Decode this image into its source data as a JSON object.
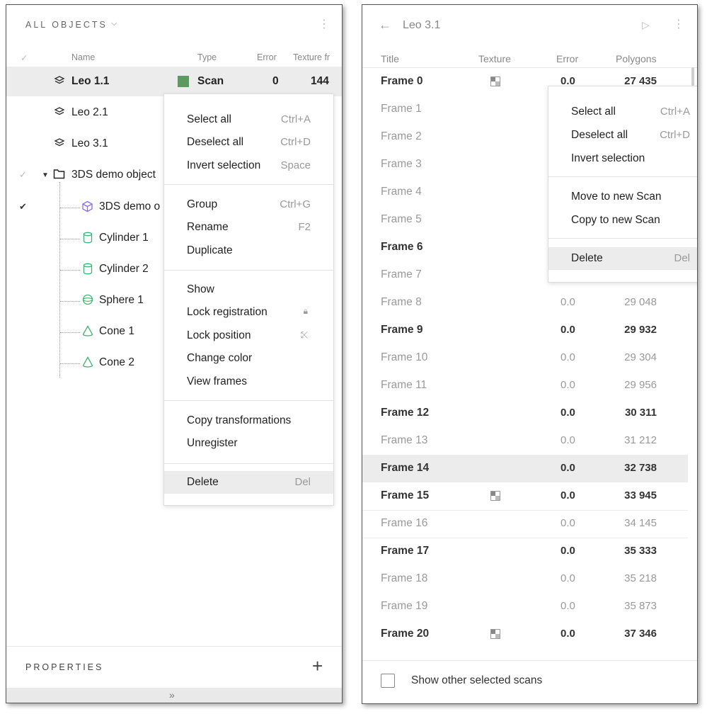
{
  "left_panel": {
    "header": {
      "title": "ALL OBJECTS",
      "chevron": "⌵",
      "kebab": "⋮"
    },
    "columns": {
      "check": "✓",
      "name": "Name",
      "type": "Type",
      "error": "Error",
      "texture": "Texture fr"
    },
    "rows": [
      {
        "label": "Leo 1.1",
        "type": "Scan",
        "error": "0",
        "texture": "144",
        "icon": "layers-icon"
      },
      {
        "label": "Leo 2.1",
        "icon": "layers-icon"
      },
      {
        "label": "Leo 3.1",
        "icon": "layers-icon"
      },
      {
        "label": "3DS demo object",
        "icon": "folder-icon",
        "check": "✓"
      },
      {
        "label": "3DS demo o",
        "icon": "cube-icon",
        "check": "✔"
      },
      {
        "label": "Cylinder 1",
        "icon": "cylinder-icon"
      },
      {
        "label": "Cylinder 2",
        "icon": "cylinder-icon"
      },
      {
        "label": "Sphere 1",
        "icon": "sphere-icon"
      },
      {
        "label": "Cone 1",
        "icon": "cone-icon"
      },
      {
        "label": "Cone 2",
        "icon": "cone-icon"
      }
    ],
    "context_menu": [
      {
        "label": "Select all",
        "shortcut": "Ctrl+A"
      },
      {
        "label": "Deselect all",
        "shortcut": "Ctrl+D"
      },
      {
        "label": "Invert selection",
        "shortcut": "Space"
      },
      {
        "label": "Group",
        "shortcut": "Ctrl+G"
      },
      {
        "label": "Rename",
        "shortcut": "F2"
      },
      {
        "label": "Duplicate",
        "shortcut": ""
      },
      {
        "label": "Show",
        "shortcut": ""
      },
      {
        "label": "Lock registration",
        "shortcut": "🔒︎"
      },
      {
        "label": "Lock position",
        "shortcut": "⤪"
      },
      {
        "label": "Change color",
        "shortcut": ""
      },
      {
        "label": "View frames",
        "shortcut": ""
      },
      {
        "label": "Copy transformations",
        "shortcut": ""
      },
      {
        "label": "Unregister",
        "shortcut": ""
      },
      {
        "label": "Delete",
        "shortcut": "Del"
      }
    ],
    "properties": {
      "title": "PROPERTIES",
      "add": "+"
    },
    "expand": "»",
    "colors": {
      "scan_swatch": "#5b9a62",
      "cube_icon": "#8a6ce0",
      "primitive_icon": "#3cb371",
      "selection": "#ececec"
    }
  },
  "right_panel": {
    "header": {
      "back": "←",
      "title": "Leo 3.1",
      "play": "▷",
      "kebab": "⋮"
    },
    "columns": {
      "title": "Title",
      "texture": "Texture",
      "error": "Error",
      "polygons": "Polygons"
    },
    "frames": [
      {
        "title": "Frame 0",
        "error": "0.0",
        "polygons": "27 435"
      },
      {
        "title": "Frame 1"
      },
      {
        "title": "Frame 2"
      },
      {
        "title": "Frame 3"
      },
      {
        "title": "Frame 4"
      },
      {
        "title": "Frame 5"
      },
      {
        "title": "Frame 6"
      },
      {
        "title": "Frame 7"
      },
      {
        "title": "Frame 8",
        "error": "0.0",
        "polygons": "29 048"
      },
      {
        "title": "Frame 9",
        "error": "0.0",
        "polygons": "29 932"
      },
      {
        "title": "Frame 10",
        "error": "0.0",
        "polygons": "29 304"
      },
      {
        "title": "Frame 11",
        "error": "0.0",
        "polygons": "29 956"
      },
      {
        "title": "Frame 12",
        "error": "0.0",
        "polygons": "30 311"
      },
      {
        "title": "Frame 13",
        "error": "0.0",
        "polygons": "31 212"
      },
      {
        "title": "Frame 14",
        "error": "0.0",
        "polygons": "32 738"
      },
      {
        "title": "Frame 15",
        "error": "0.0",
        "polygons": "33 945"
      },
      {
        "title": "Frame 16",
        "error": "0.0",
        "polygons": "34 145"
      },
      {
        "title": "Frame 17",
        "error": "0.0",
        "polygons": "35 333"
      },
      {
        "title": "Frame 18",
        "error": "0.0",
        "polygons": "35 218"
      },
      {
        "title": "Frame 19",
        "error": "0.0",
        "polygons": "35 873"
      },
      {
        "title": "Frame 20",
        "error": "0.0",
        "polygons": "37 346"
      }
    ],
    "context_menu": [
      {
        "label": "Select all",
        "shortcut": "Ctrl+A"
      },
      {
        "label": "Deselect all",
        "shortcut": "Ctrl+D"
      },
      {
        "label": "Invert selection",
        "shortcut": ""
      },
      {
        "label": "Move to new Scan",
        "shortcut": ""
      },
      {
        "label": "Copy to new Scan",
        "shortcut": ""
      },
      {
        "label": "Delete",
        "shortcut": "Del"
      }
    ],
    "footer": {
      "checkbox_label": "Show other selected scans"
    }
  }
}
